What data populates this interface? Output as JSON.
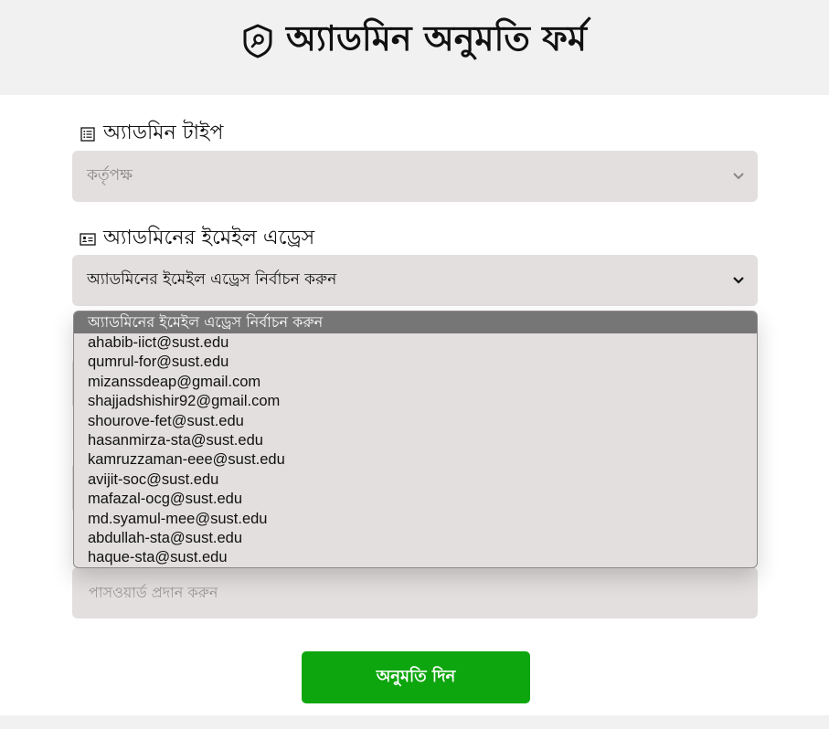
{
  "header": {
    "title": "অ্যাডমিন অনুমতি ফর্ম",
    "icon": "shield-key-icon"
  },
  "admin_type": {
    "label": "অ্যাডমিন টাইপ",
    "icon": "list-icon",
    "value": "কর্তৃপক্ষ"
  },
  "admin_email": {
    "label": "অ্যাডমিনের ইমেইল এড্রেস",
    "icon": "id-card-icon",
    "value": "অ্যাডমিনের ইমেইল এড্রেস নির্বাচন করুন"
  },
  "dropdown": {
    "options": [
      "অ্যাডমিনের ইমেইল এড্রেস নির্বাচন করুন",
      "ahabib-iict@sust.edu",
      "qumrul-for@sust.edu",
      "mizanssdeap@gmail.com",
      "shajjadshishir92@gmail.com",
      "shourove-fet@sust.edu",
      "hasanmirza-sta@sust.edu",
      "kamruzzaman-eee@sust.edu",
      "avijit-soc@sust.edu",
      "mafazal-ocg@sust.edu",
      "md.syamul-mee@sust.edu",
      "abdullah-sta@sust.edu",
      "haque-sta@sust.edu"
    ],
    "selected_index": 0
  },
  "password": {
    "placeholder": "পাসওয়ার্ড প্রদান করুন"
  },
  "submit": {
    "label": "অনুমতি দিন",
    "color": "#0ea60e"
  }
}
